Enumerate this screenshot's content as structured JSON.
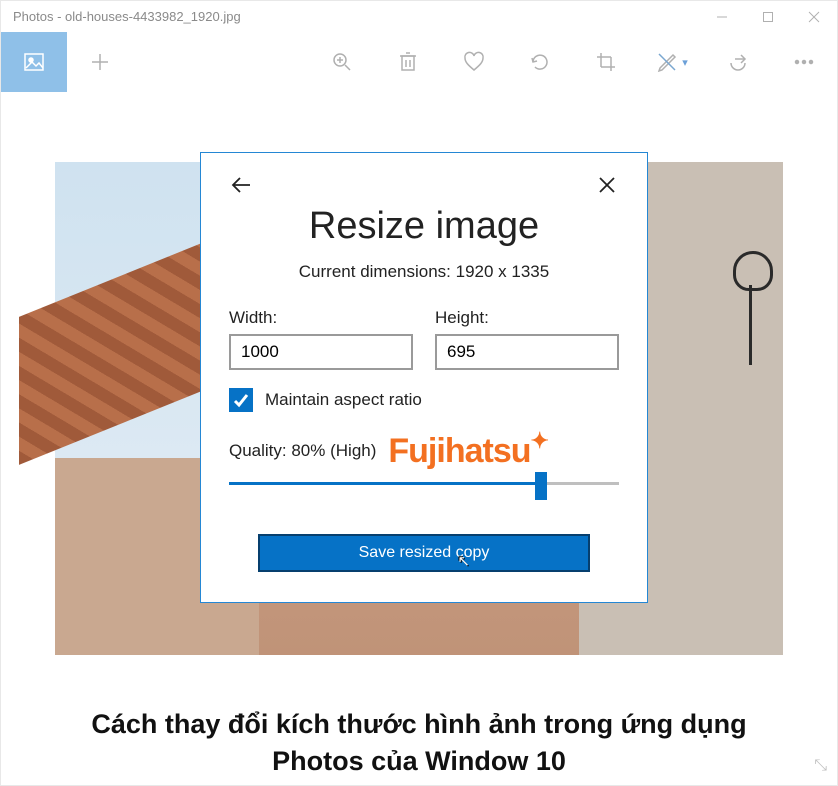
{
  "titlebar": {
    "title": "Photos - old-houses-4433982_1920.jpg"
  },
  "toolbar": {
    "view_icon": "image-icon",
    "add_icon": "plus-icon",
    "zoom_icon": "zoom-in-icon",
    "delete_icon": "trash-icon",
    "favorite_icon": "heart-icon",
    "rotate_icon": "rotate-icon",
    "crop_icon": "crop-icon",
    "draw_icon": "draw-icon",
    "share_icon": "share-icon",
    "more_icon": "more-icon"
  },
  "dialog": {
    "title": "Resize image",
    "dimensions_label": "Current dimensions: 1920 x 1335",
    "width_label": "Width:",
    "width_value": "1000",
    "height_label": "Height:",
    "height_value": "695",
    "aspect_label": "Maintain aspect ratio",
    "aspect_checked": true,
    "quality_label": "Quality: 80% (High)",
    "quality_percent": 80,
    "brand": "Fujihatsu",
    "save_label": "Save resized copy"
  },
  "caption": {
    "line1": "Cách thay đổi kích thước hình ảnh trong ứng dụng",
    "line2": "Photos của Window 10"
  }
}
